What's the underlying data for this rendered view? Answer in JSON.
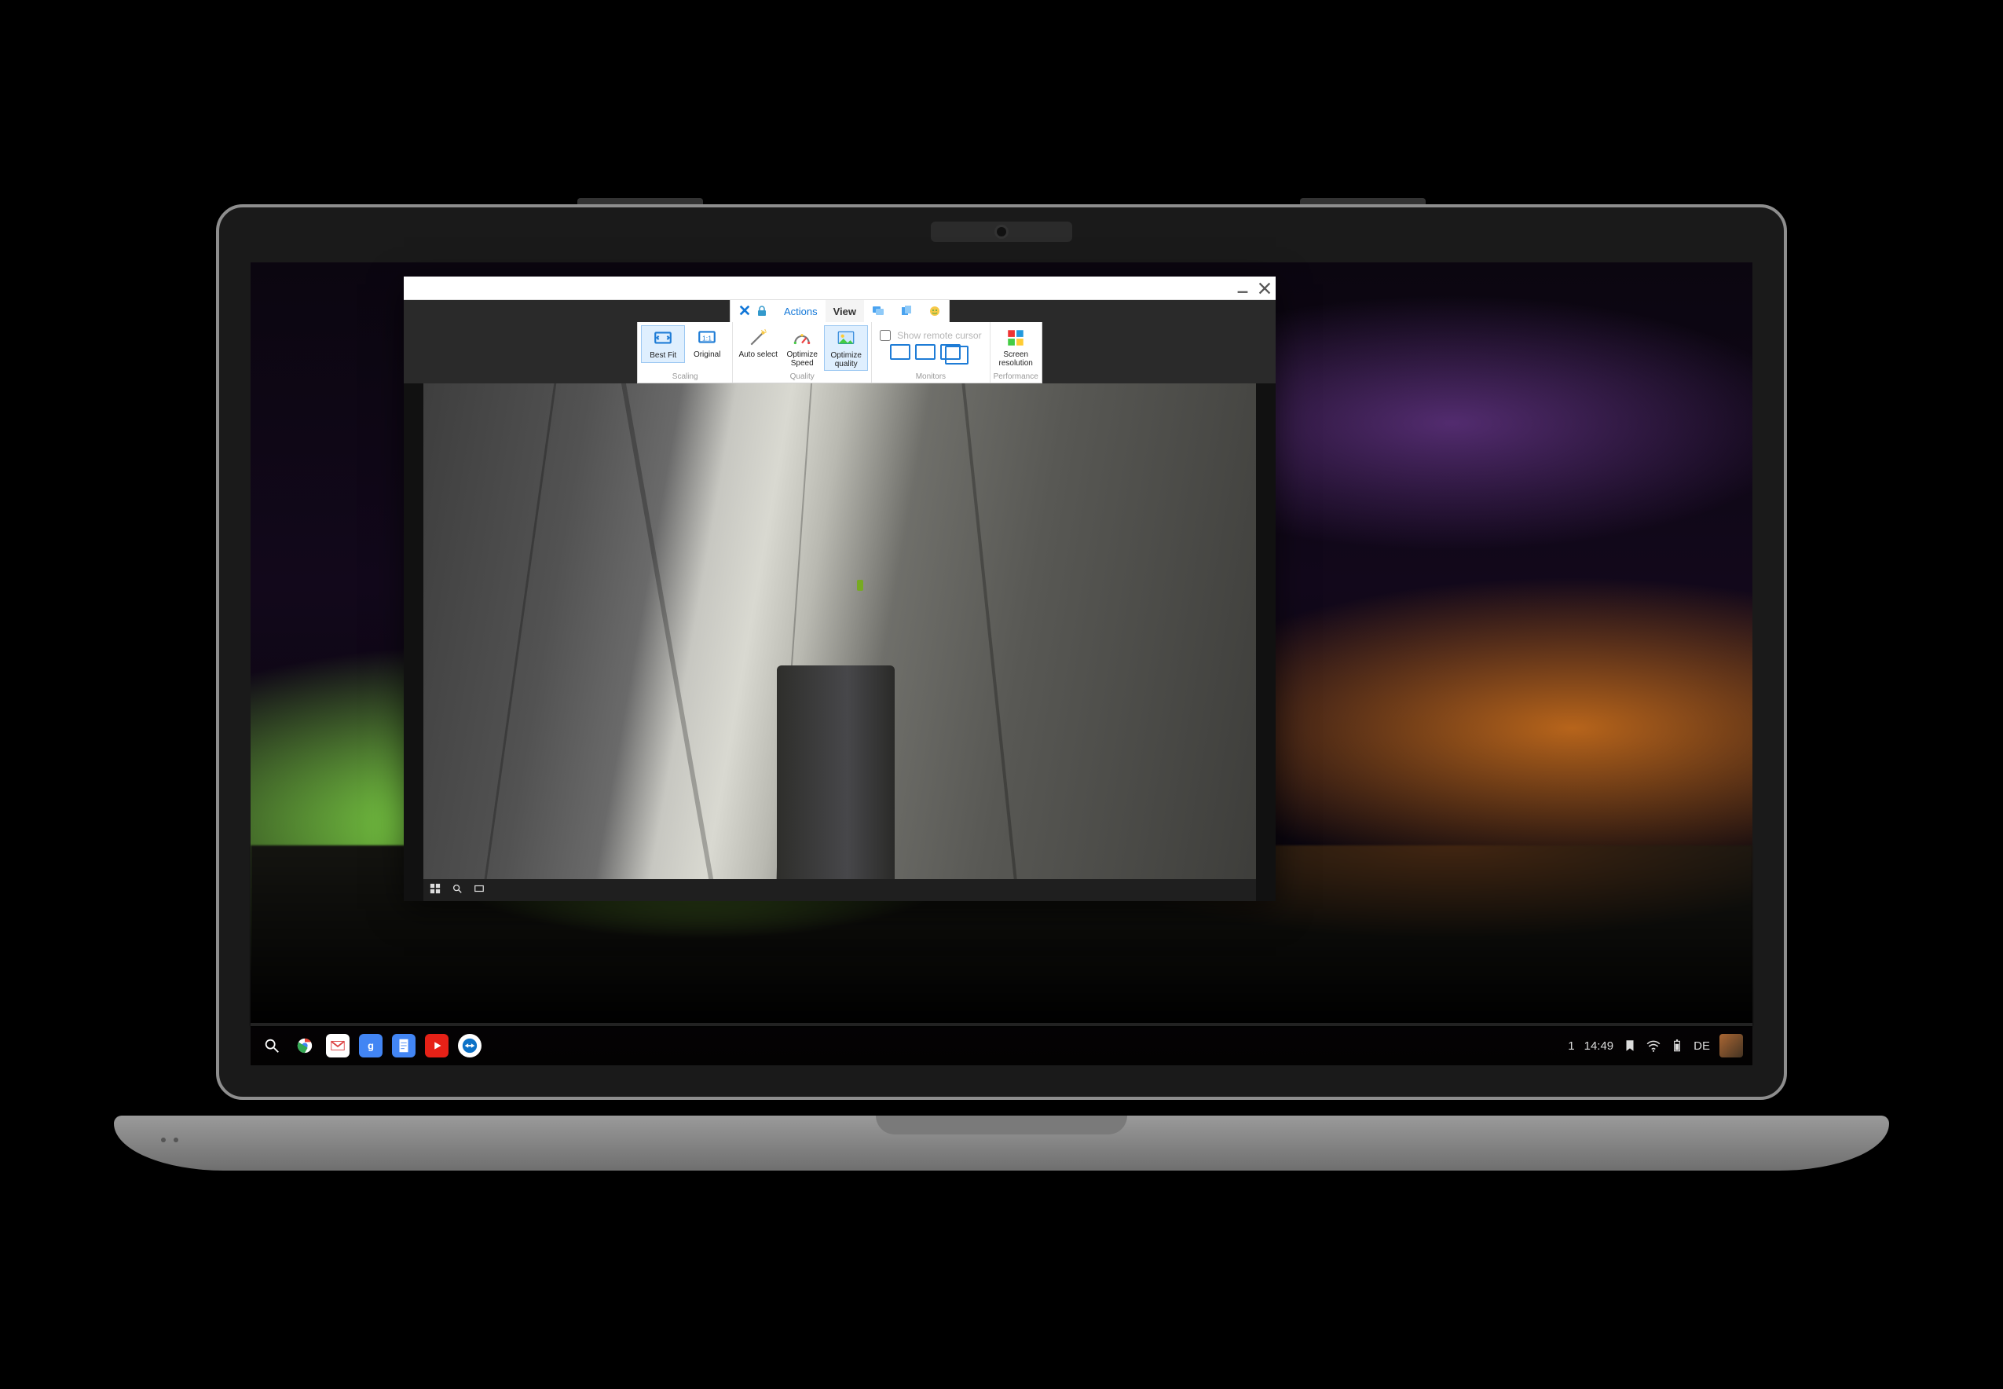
{
  "teamviewer": {
    "tabs": {
      "actions": "Actions",
      "view": "View"
    },
    "ribbon": {
      "best_fit": "Best Fit",
      "original": "Original",
      "scaling_group": "Scaling",
      "auto_select": "Auto select",
      "optimize_speed": "Optimize Speed",
      "optimize_quality": "Optimize quality",
      "quality_group": "Quality",
      "show_remote_cursor": "Show remote cursor",
      "monitors_group": "Monitors",
      "screen_resolution": "Screen resolution",
      "performance_group": "Performance"
    }
  },
  "chromeos": {
    "status": {
      "notif_count": "1",
      "time": "14:49",
      "lang": "DE"
    }
  }
}
